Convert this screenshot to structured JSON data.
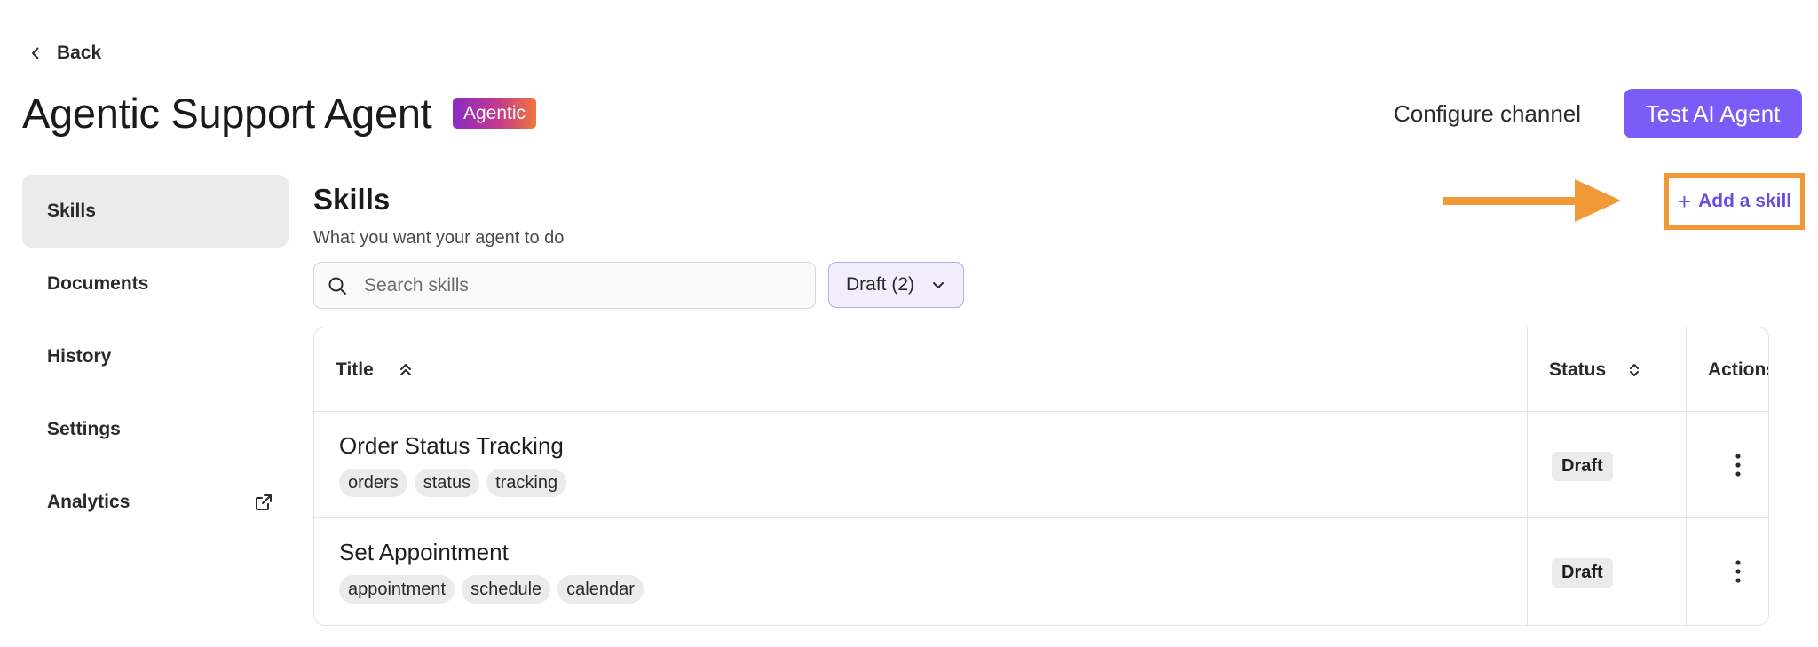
{
  "nav": {
    "back_label": "Back"
  },
  "header": {
    "title": "Agentic Support Agent",
    "badge": "Agentic",
    "configure_label": "Configure channel",
    "test_label": "Test AI Agent"
  },
  "sidebar": {
    "items": [
      {
        "label": "Skills",
        "active": true
      },
      {
        "label": "Documents"
      },
      {
        "label": "History"
      },
      {
        "label": "Settings"
      },
      {
        "label": "Analytics",
        "icon": "external-link-icon"
      }
    ]
  },
  "main": {
    "title": "Skills",
    "subtitle": "What you want your agent to do",
    "add_skill_label": "Add a skill",
    "add_skill_icon": "plus-icon",
    "search": {
      "placeholder": "Search skills",
      "value": ""
    },
    "filter": {
      "label": "Draft (2)"
    },
    "table": {
      "columns": {
        "title": "Title",
        "status": "Status",
        "actions": "Actions"
      },
      "rows": [
        {
          "name": "Order Status Tracking",
          "tags": [
            "orders",
            "status",
            "tracking"
          ],
          "status": "Draft"
        },
        {
          "name": "Set Appointment",
          "tags": [
            "appointment",
            "schedule",
            "calendar"
          ],
          "status": "Draft"
        }
      ]
    }
  },
  "colors": {
    "accent": "#7b5cf7",
    "annotation": "#f29937",
    "badge_gradient": [
      "#8a2bc5",
      "#c43a8a",
      "#f0783c"
    ]
  }
}
